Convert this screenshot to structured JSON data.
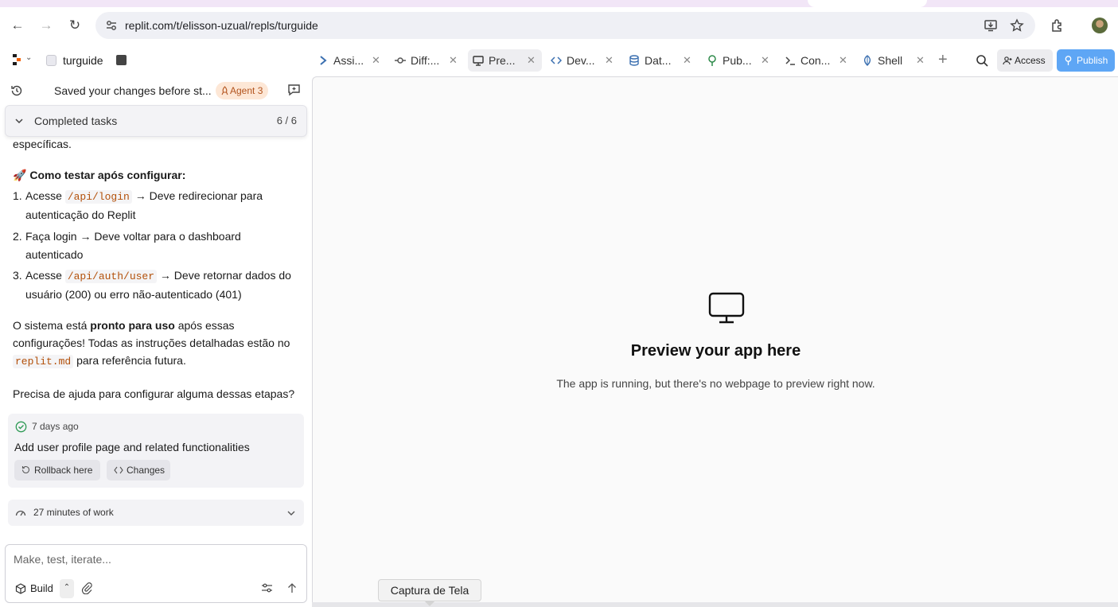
{
  "browser": {
    "url": "replit.com/t/elisson-uzual/repls/turguide"
  },
  "app": {
    "project_name": "turguide",
    "tabs": [
      {
        "label": "Assi...",
        "icon": "agent-icon"
      },
      {
        "label": "Diff:...",
        "icon": "git-commit-icon"
      },
      {
        "label": "Pre...",
        "icon": "monitor-icon",
        "active": true
      },
      {
        "label": "Dev...",
        "icon": "code-icon"
      },
      {
        "label": "Dat...",
        "icon": "database-icon"
      },
      {
        "label": "Pub...",
        "icon": "publish-icon"
      },
      {
        "label": "Con...",
        "icon": "terminal-icon"
      },
      {
        "label": "Shell",
        "icon": "shell-icon"
      }
    ],
    "access_label": "Access",
    "publish_label": "Publish"
  },
  "left": {
    "saved_text": "Saved your changes before st...",
    "agent_badge": "Agent 3",
    "tasks_label": "Completed tasks",
    "tasks_count": "6 / 6",
    "truncated_line": "específicas.",
    "test_heading": "Como testar após configurar:",
    "steps": [
      {
        "n": "1.",
        "pre": "Acesse ",
        "code": "/api/login",
        "post": " → Deve redirecionar para autenticação do Replit"
      },
      {
        "n": "2.",
        "pre": "Faça login → Deve voltar para o dashboard autenticado",
        "code": "",
        "post": ""
      },
      {
        "n": "3.",
        "pre": "Acesse ",
        "code": "/api/auth/user",
        "post": " → Deve retornar dados do usuário (200) ou erro não-autenticado (401)"
      }
    ],
    "summary_pre": "O sistema está ",
    "summary_bold": "pronto para uso",
    "summary_mid": " após essas configurações! Todas as instruções detalhadas estão no ",
    "summary_code": "replit.md",
    "summary_post": " para referência futura.",
    "question": "Precisa de ajuda para configurar alguma dessas etapas?",
    "checkpoint": {
      "time": "7 days ago",
      "title": "Add user profile page and related functionalities",
      "rollback_label": "Rollback here",
      "changes_label": "Changes"
    },
    "work_label": "27 minutes of work",
    "input_placeholder": "Make, test, iterate...",
    "build_label": "Build"
  },
  "preview": {
    "title": "Preview your app here",
    "subtitle": "The app is running, but there's no webpage to preview right now."
  },
  "tooltip": "Captura de Tela"
}
